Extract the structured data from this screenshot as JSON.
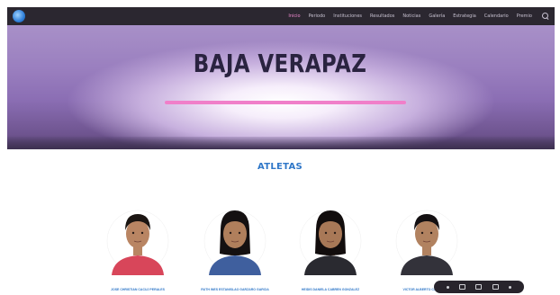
{
  "nav": {
    "logo_icon": "globe-logo-icon",
    "items": [
      {
        "label": "Inicio",
        "active": true
      },
      {
        "label": "Periodo",
        "active": false
      },
      {
        "label": "Instituciones",
        "active": false
      },
      {
        "label": "Resultados",
        "active": false
      },
      {
        "label": "Noticias",
        "active": false
      },
      {
        "label": "Galería",
        "active": false
      },
      {
        "label": "Estrategia",
        "active": false
      },
      {
        "label": "Calendario",
        "active": false
      },
      {
        "label": "Premio",
        "active": false
      }
    ],
    "search_icon": "search-icon",
    "active_color": "#f08ad0"
  },
  "hero": {
    "title": "BAJA VERAPAZ",
    "accent_color": "#f07fc9"
  },
  "section": {
    "heading": "ATLETAS",
    "heading_color": "#2f77c8"
  },
  "athletes": [
    {
      "name": "JOSE CHRISTIAN CACUJ PERALES",
      "shirt_color": "#d8465a",
      "skin": "#b98563",
      "hair": "#1b1512",
      "long_hair": false
    },
    {
      "name": "RUTH INES ESTANISLAO GARZARO GARCIA",
      "shirt_color": "#3f5f9e",
      "skin": "#b07f5c",
      "hair": "#141011",
      "long_hair": true
    },
    {
      "name": "HEIDIS DANIELA CABREN GONZALEZ",
      "shirt_color": "#2a2a30",
      "skin": "#a87857",
      "hair": "#120d0d",
      "long_hair": true
    },
    {
      "name": "VICTOR ALBERTO CAAL ORTIZ",
      "shirt_color": "#33323a",
      "skin": "#b18260",
      "hair": "#141012",
      "long_hair": false
    }
  ],
  "viewer_toolbar": {
    "icons": [
      "prev-icon",
      "page-icon",
      "fit-icon",
      "zoom-icon",
      "more-icon"
    ]
  }
}
